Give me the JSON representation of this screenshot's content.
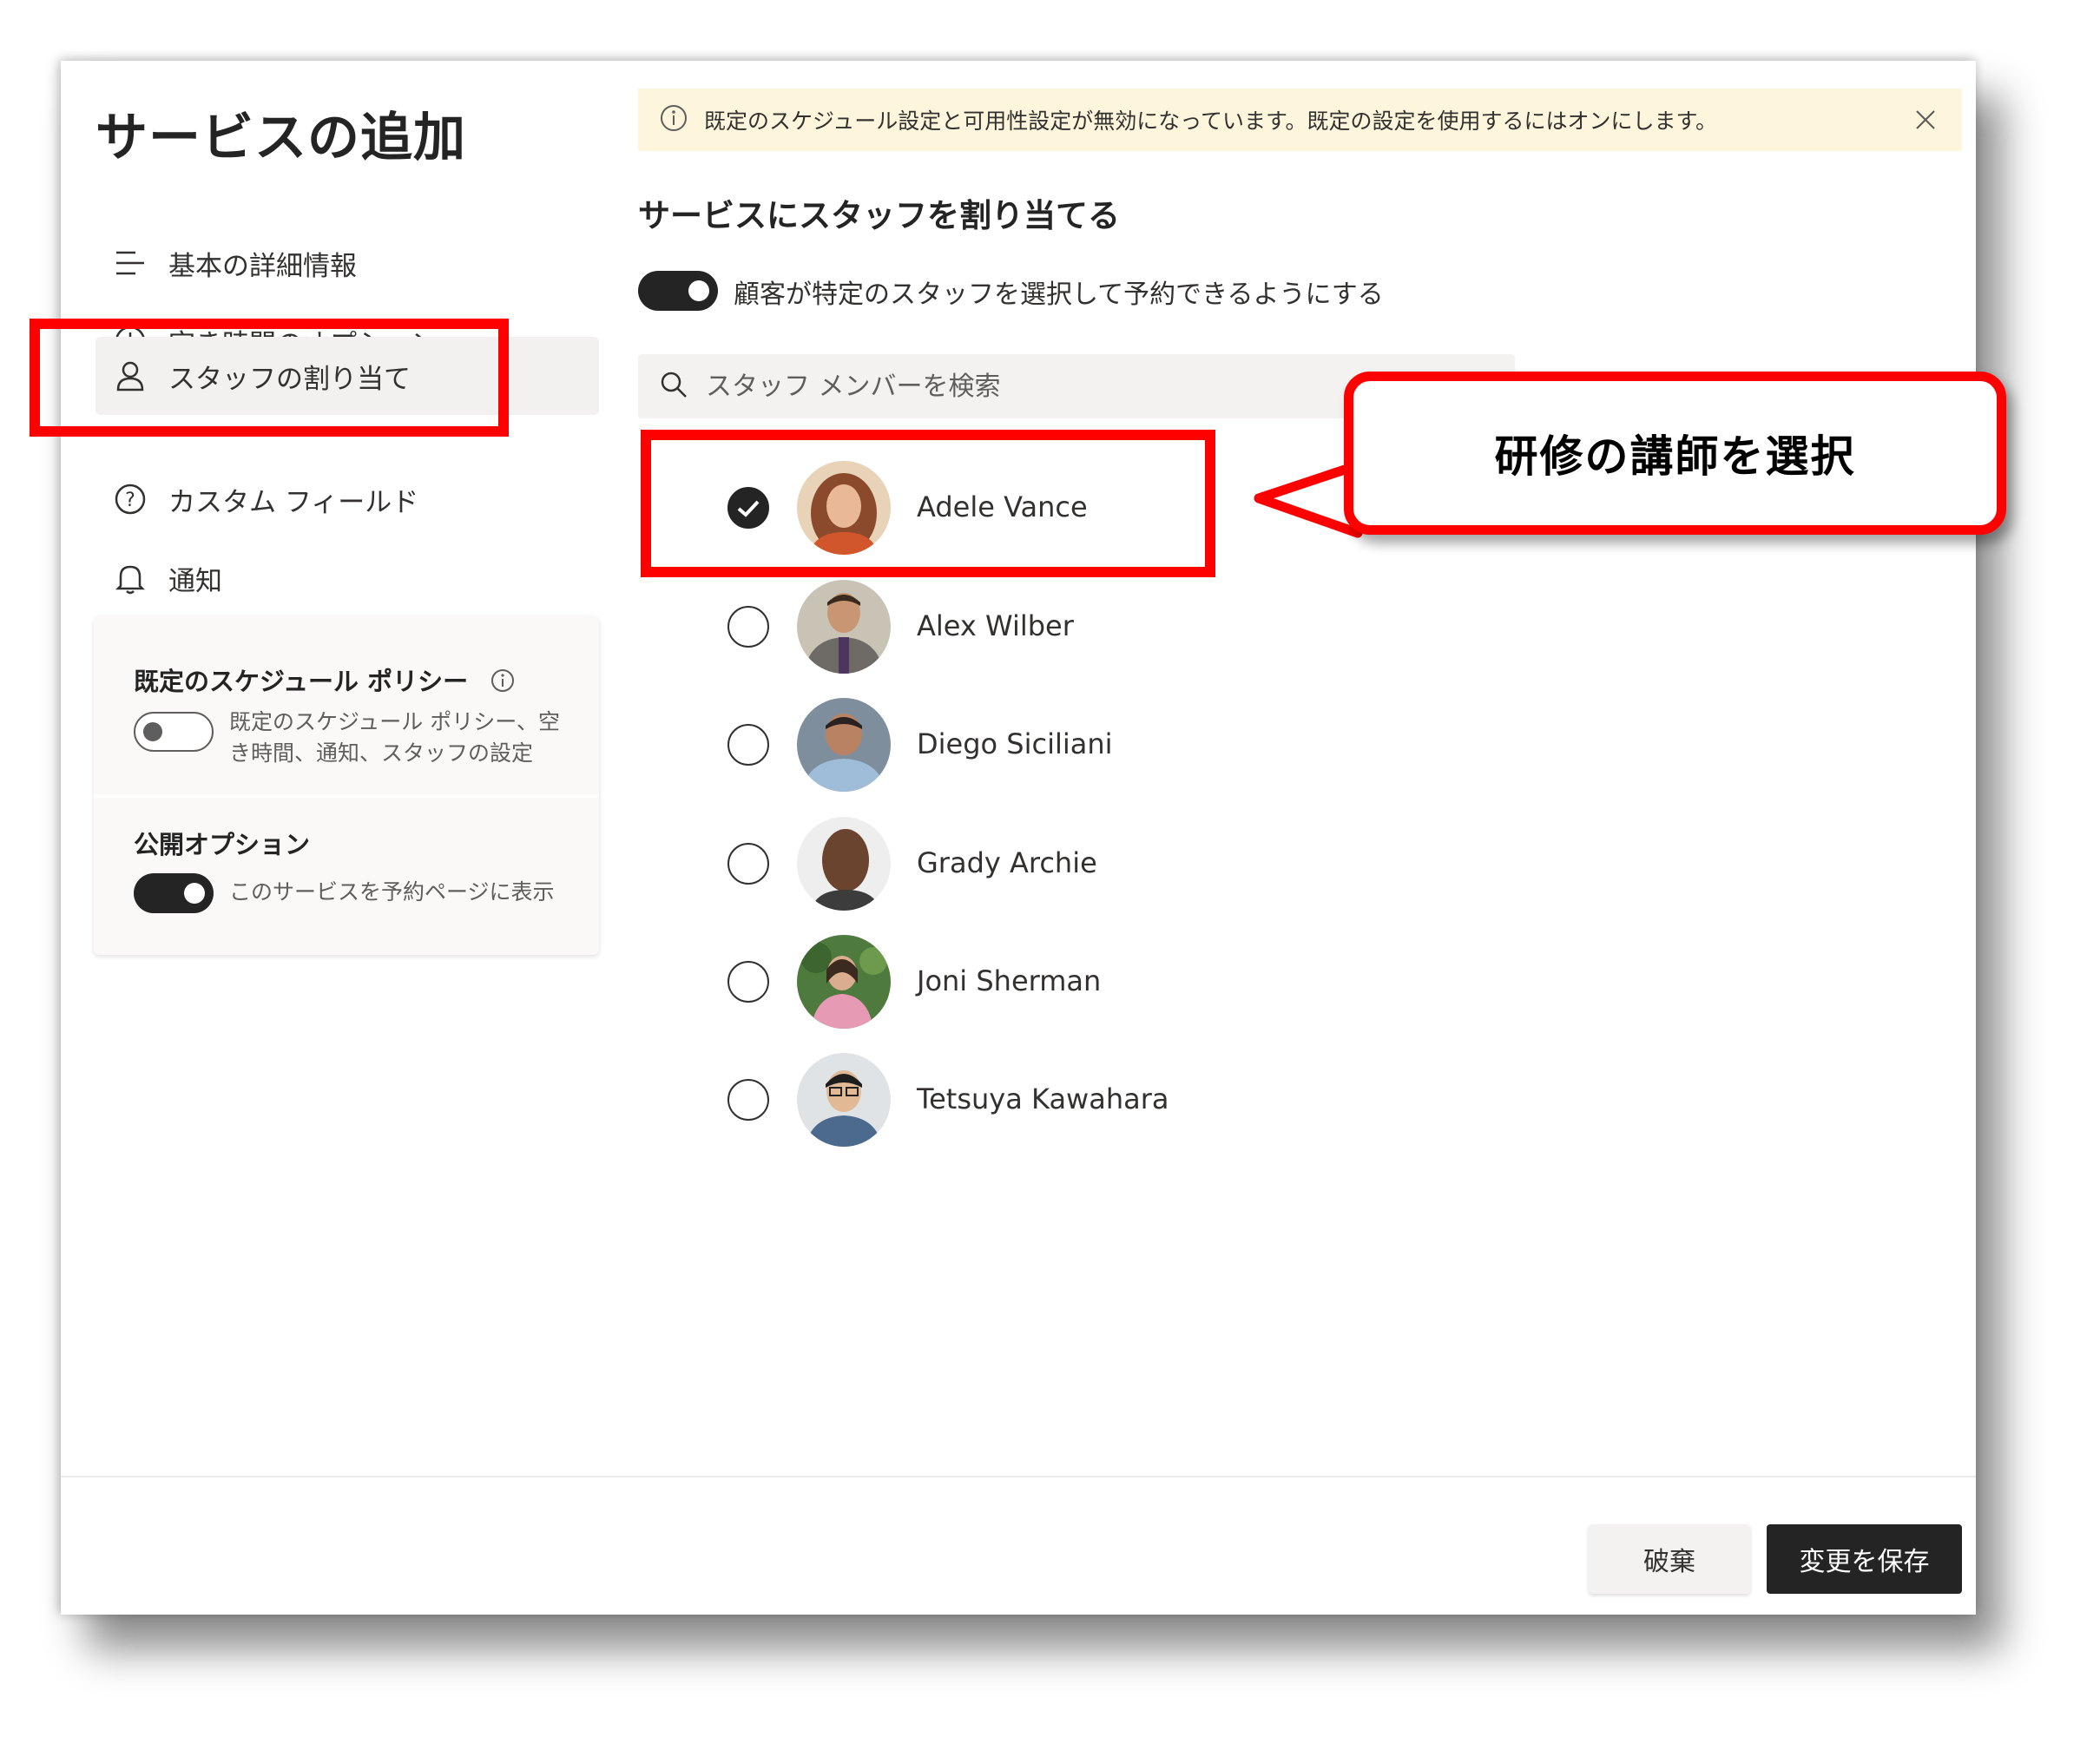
{
  "dialog": {
    "title": "サービスの追加"
  },
  "nav": {
    "items": [
      {
        "label": "基本の詳細情報",
        "icon": "list-icon"
      },
      {
        "label": "空き時間のオプション",
        "icon": "clock-icon"
      },
      {
        "label": "スタッフの割り当て",
        "icon": "person-icon",
        "active": true
      },
      {
        "label": "カスタム フィールド",
        "icon": "question-icon"
      },
      {
        "label": "通知",
        "icon": "bell-icon"
      }
    ]
  },
  "policy": {
    "heading": "既定のスケジュール ポリシー",
    "toggle_text": "既定のスケジュール ポリシー、空き時間、通知、スタッフの設定",
    "toggle_state": "off"
  },
  "publish": {
    "heading": "公開オプション",
    "toggle_text": "このサービスを予約ページに表示",
    "toggle_state": "on"
  },
  "banner": {
    "message": "既定のスケジュール設定と可用性設定が無効になっています。既定の設定を使用するにはオンにします。"
  },
  "assign": {
    "section_title": "サービスにスタッフを割り当てる",
    "allow_select_label": "顧客が特定のスタッフを選択して予約できるようにする",
    "allow_select_state": "on",
    "search_placeholder": "スタッフ メンバーを検索"
  },
  "staff": [
    {
      "name": "Adele Vance",
      "checked": true
    },
    {
      "name": "Alex Wilber",
      "checked": false
    },
    {
      "name": "Diego Siciliani",
      "checked": false
    },
    {
      "name": "Grady Archie",
      "checked": false
    },
    {
      "name": "Joni Sherman",
      "checked": false
    },
    {
      "name": "Tetsuya Kawahara",
      "checked": false
    }
  ],
  "footer": {
    "discard_label": "破棄",
    "save_label": "変更を保存"
  },
  "annotation": {
    "callout_text": "研修の講師を選択",
    "highlight_color": "#ff0000"
  }
}
